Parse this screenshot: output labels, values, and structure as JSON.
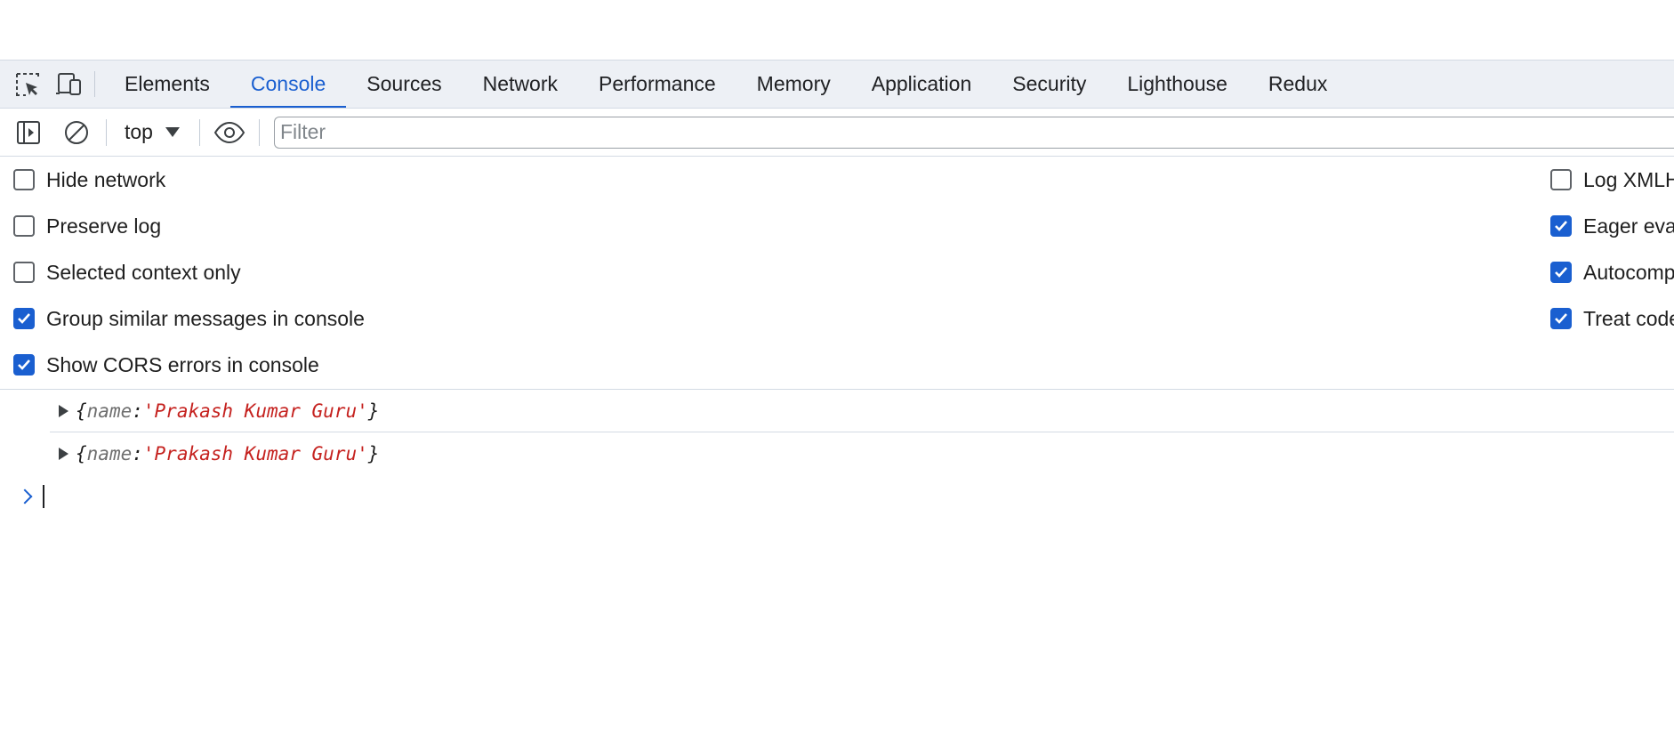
{
  "tabs": [
    {
      "label": "Elements",
      "active": false
    },
    {
      "label": "Console",
      "active": true
    },
    {
      "label": "Sources",
      "active": false
    },
    {
      "label": "Network",
      "active": false
    },
    {
      "label": "Performance",
      "active": false
    },
    {
      "label": "Memory",
      "active": false
    },
    {
      "label": "Application",
      "active": false
    },
    {
      "label": "Security",
      "active": false
    },
    {
      "label": "Lighthouse",
      "active": false
    },
    {
      "label": "Redux",
      "active": false
    }
  ],
  "toolbar": {
    "context": "top",
    "filter_placeholder": "Filter",
    "icons": [
      "sidebar-toggle-icon",
      "clear-console-icon",
      "eye-icon"
    ]
  },
  "settings": {
    "left": [
      {
        "label": "Hide network",
        "checked": false
      },
      {
        "label": "Preserve log",
        "checked": false
      },
      {
        "label": "Selected context only",
        "checked": false
      },
      {
        "label": "Group similar messages in console",
        "checked": true
      },
      {
        "label": "Show CORS errors in console",
        "checked": true
      }
    ],
    "right": [
      {
        "label": "Log XMLHttpRequests",
        "checked": false
      },
      {
        "label": "Eager evaluation",
        "checked": true
      },
      {
        "label": "Autocomplete from history",
        "checked": true
      },
      {
        "label": "Treat code evaluation as user action",
        "checked": true
      }
    ]
  },
  "messages": [
    {
      "open": "{",
      "key": "name",
      "colon": ": ",
      "value": "'Prakash Kumar Guru'",
      "close": "}"
    },
    {
      "open": "{",
      "key": "name",
      "colon": ": ",
      "value": "'Prakash Kumar Guru'",
      "close": "}"
    }
  ],
  "colors": {
    "accent": "#1a5fd0",
    "string": "#c5221f",
    "tabbar_bg": "#edf0f5",
    "border": "#d3dae4"
  }
}
